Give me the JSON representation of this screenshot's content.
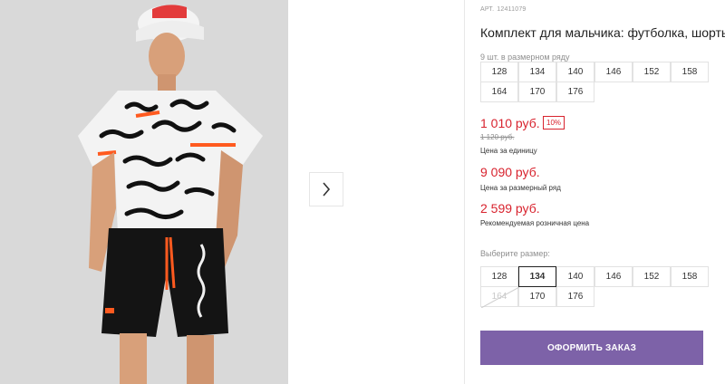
{
  "product": {
    "sku_label": "АРТ.",
    "sku_value": "12411079",
    "title": "Комплект для мальчика: футболка, шорты",
    "row_note": "9 шт. в размерном ряду",
    "row_sizes": [
      "128",
      "134",
      "140",
      "146",
      "152",
      "158",
      "164",
      "170",
      "176"
    ]
  },
  "prices": {
    "unit_price": "1 010 руб.",
    "discount": "10%",
    "old_price": "1 120 руб.",
    "unit_label": "Цена за единицу",
    "row_price": "9 090 руб.",
    "row_label": "Цена за размерный ряд",
    "rrp_price": "2 599 руб.",
    "rrp_label": "Рекомендуемая розничная цена"
  },
  "size_picker": {
    "label": "Выберите размер:",
    "sizes": [
      "128",
      "134",
      "140",
      "146",
      "152",
      "158",
      "164",
      "170",
      "176"
    ],
    "selected": "134",
    "unavailable": [
      "164"
    ]
  },
  "actions": {
    "order_label": "ОФОРМИТЬ ЗАКАЗ"
  },
  "gallery": {
    "next_icon": "chevron-right-icon"
  },
  "colors": {
    "price_red": "#d8232e",
    "button_purple": "#7d62a8",
    "accent_orange": "#ff5a1f"
  }
}
